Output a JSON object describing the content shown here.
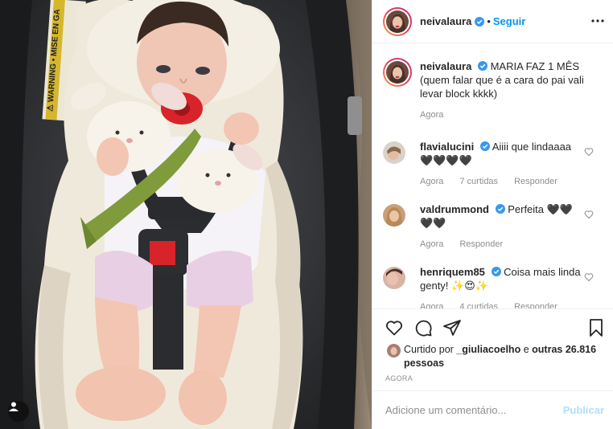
{
  "post": {
    "author": "neivalaura",
    "follow_label": "Seguir",
    "dot": "•"
  },
  "caption": {
    "username": "neivalaura",
    "text": "MARIA FAZ 1 MÊS (quem falar que é a cara do pai vali levar block kkkk)",
    "time": "Agora"
  },
  "comments": [
    {
      "username": "flavialucini",
      "text": "Aiiii que lindaaaa🖤🖤🖤🖤",
      "time": "Agora",
      "likes": "7 curtidas",
      "reply": "Responder"
    },
    {
      "username": "valdrummond",
      "text": "Perfeita 🖤🖤🖤🖤",
      "time": "Agora",
      "likes": "",
      "reply": "Responder"
    },
    {
      "username": "henriquem85",
      "text": "Coisa mais linda genty! ✨😍✨",
      "time": "Agora",
      "likes": "4 curtidas",
      "reply": "Responder"
    }
  ],
  "likes": {
    "prefix": "Curtido por",
    "user": "_giuliacoelho",
    "middle": "e",
    "others": "outras 26.816 pessoas"
  },
  "post_time": "AGORA",
  "add_comment": {
    "placeholder": "Adicione um comentário...",
    "publish_label": "Publicar"
  },
  "colors": {
    "accent": "#0095f6",
    "verified": "#3897f0",
    "publish_disabled": "#b2dffc",
    "meta_gray": "#8e8e8e",
    "seat_dark": "#2f3033",
    "liner_cream": "#efe9dc",
    "pacifier_red": "#d8232a"
  },
  "icons": [
    "verified-badge-icon",
    "more-options-icon",
    "heart-icon",
    "comment-icon",
    "share-icon",
    "bookmark-icon",
    "user-tag-icon"
  ]
}
